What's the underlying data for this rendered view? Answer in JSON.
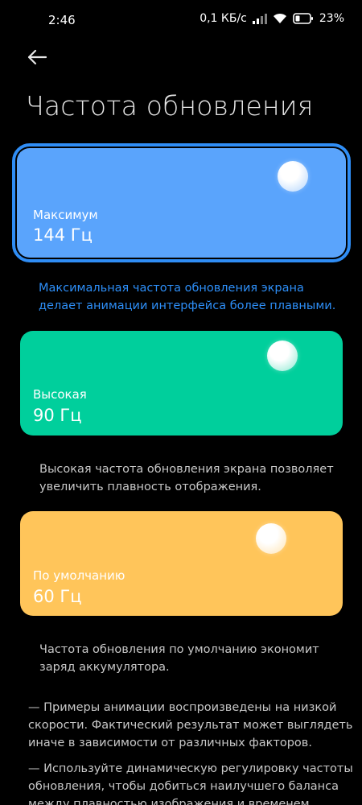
{
  "status_bar": {
    "time": "2:46",
    "speed": "0,1 КБ/с",
    "battery": "23%"
  },
  "header": {
    "title": "Частота обновления"
  },
  "modes": [
    {
      "label": "Максимум",
      "rate": "144 Гц",
      "color": "#5aa4fc",
      "selected": true,
      "description": [
        "Максимальная частота обновления экрана",
        "делает анимации интерфейса более плавными."
      ]
    },
    {
      "label": "Высокая",
      "rate": "90 Гц",
      "color": "#00cf9c",
      "selected": false,
      "description": [
        "Высокая частота обновления экрана позволяет",
        "увеличить плавность отображения."
      ]
    },
    {
      "label": "По умолчанию",
      "rate": "60 Гц",
      "color": "#ffc55a",
      "selected": false,
      "description": [
        "Частота обновления по умолчанию экономит",
        "заряд аккумулятора."
      ]
    }
  ],
  "notes": [
    [
      "— Примеры анимации воспроизведены на низкой",
      "скорости. Фактический результат может выглядеть",
      "иначе в зависимости от различных факторов."
    ],
    [
      "— Используйте динамическую регулировку частоты",
      "обновления, чтобы добиться наилучшего баланса",
      "между плавностью изображения и временем"
    ]
  ],
  "accent_color": "#2f8df5"
}
